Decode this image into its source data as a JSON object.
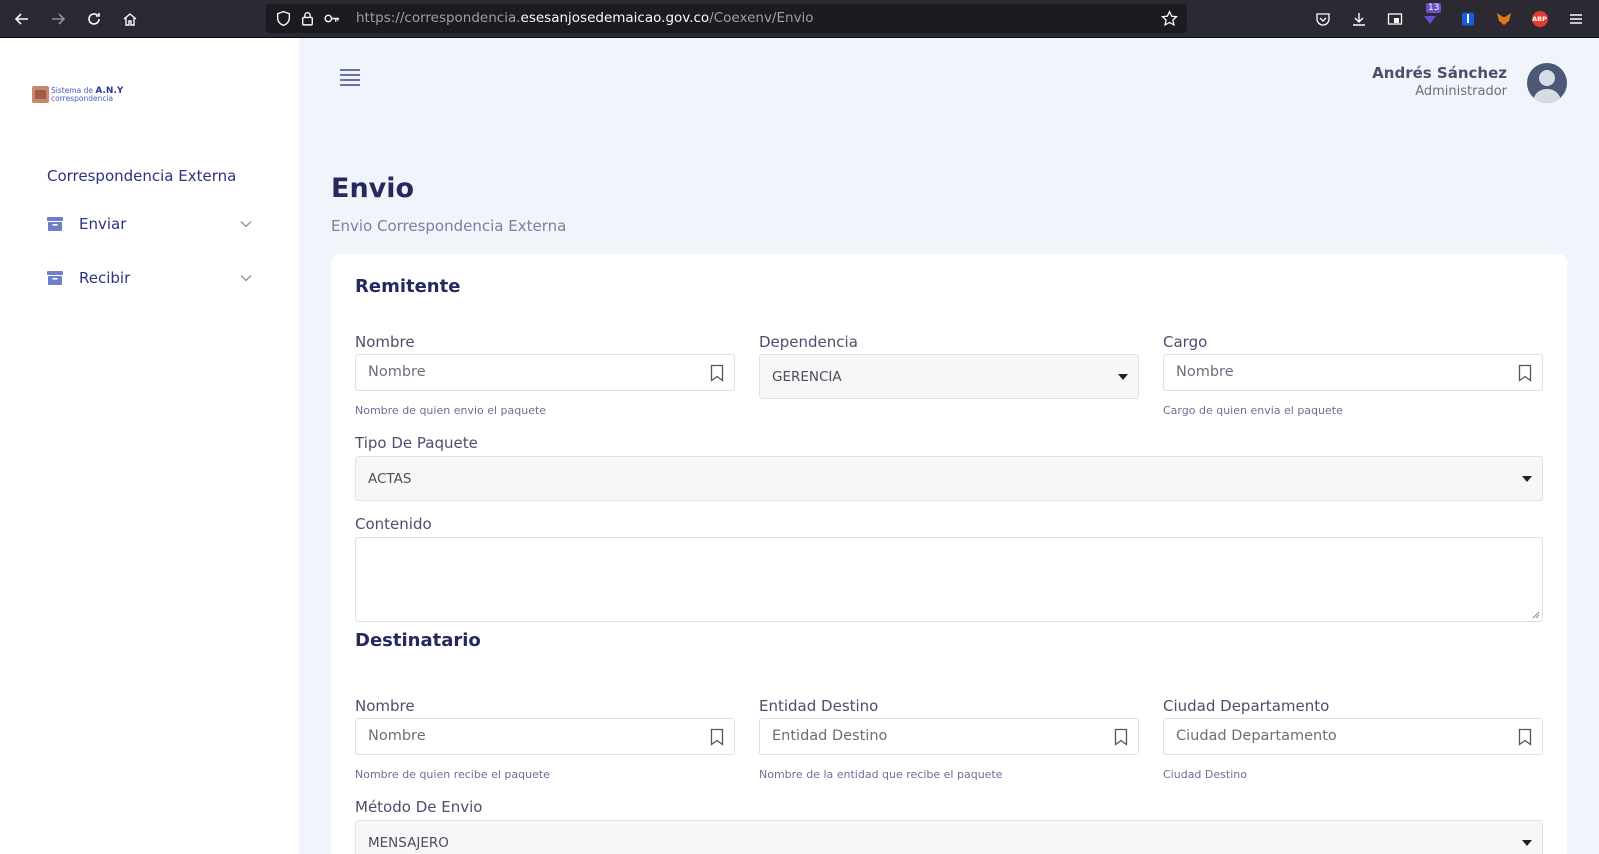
{
  "browser": {
    "url_prefix": "https://correspondencia.",
    "url_host": "esesanjosedemaicao.gov.co",
    "url_path": "/Coexenv/Envio",
    "badge_count": "13",
    "abp_label": "ABP"
  },
  "sidebar": {
    "logo_line1": "Sistema de ",
    "logo_brand": "A.N.Y",
    "logo_line2": "correspondencia",
    "section_title": "Correspondencia Externa",
    "items": [
      {
        "label": "Enviar"
      },
      {
        "label": "Recibir"
      }
    ]
  },
  "header": {
    "user_name": "Andrés Sánchez",
    "user_role": "Administrador"
  },
  "page": {
    "title": "Envio",
    "subtitle": "Envio Correspondencia Externa"
  },
  "form": {
    "remitente": {
      "heading": "Remitente",
      "nombre_label": "Nombre",
      "nombre_placeholder": "Nombre",
      "nombre_help": "Nombre de quien envio el paquete",
      "dependencia_label": "Dependencia",
      "dependencia_value": "GERENCIA",
      "cargo_label": "Cargo",
      "cargo_placeholder": "Nombre",
      "cargo_help": "Cargo de quien envia el paquete",
      "tipo_label": "Tipo De Paquete",
      "tipo_value": "ACTAS",
      "contenido_label": "Contenido",
      "contenido_value": ""
    },
    "destinatario": {
      "heading": "Destinatario",
      "nombre_label": "Nombre",
      "nombre_placeholder": "Nombre",
      "nombre_help": "Nombre de quien recibe el paquete",
      "entidad_label": "Entidad Destino",
      "entidad_placeholder": "Entidad Destino",
      "entidad_help": "Nombre de la entidad que recibe el paquete",
      "ciudad_label": "Ciudad Departamento",
      "ciudad_placeholder": "Ciudad Departamento",
      "ciudad_help": "Ciudad Destino",
      "metodo_label": "Método De Envio",
      "metodo_value": "MENSAJERO"
    }
  }
}
